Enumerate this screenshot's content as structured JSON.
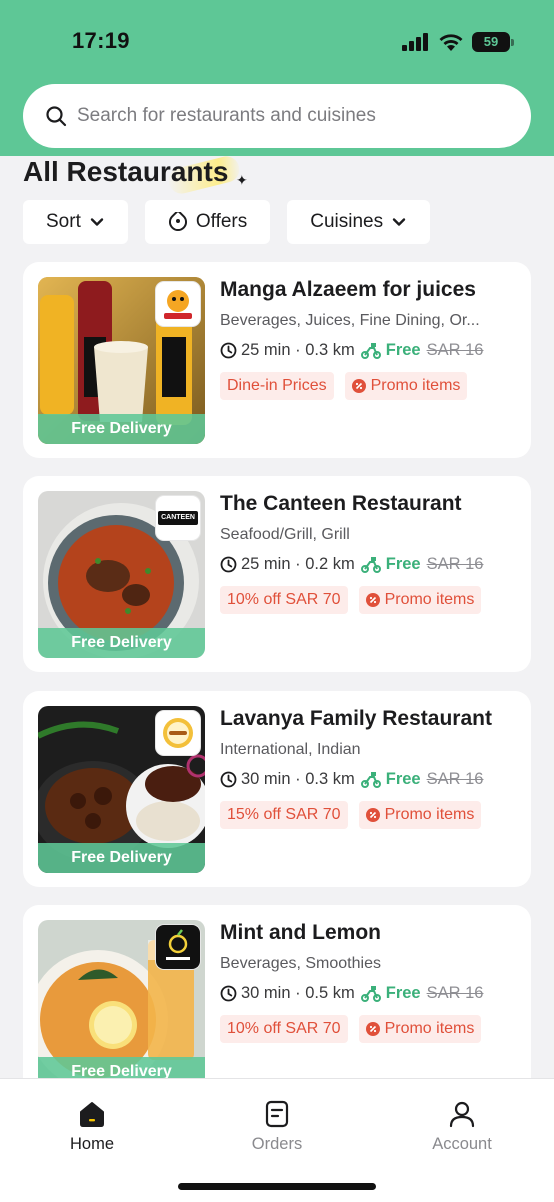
{
  "status_bar": {
    "time": "17:19",
    "battery": "59"
  },
  "search": {
    "placeholder": "Search for restaurants and cuisines"
  },
  "section": {
    "title": "All Restaurants"
  },
  "filters": [
    {
      "label": "Sort",
      "icon": "chevron-down-icon"
    },
    {
      "label": "Offers",
      "icon": "tag-icon"
    },
    {
      "label": "Cuisines",
      "icon": "chevron-down-icon"
    }
  ],
  "restaurants": [
    {
      "name": "Manga Alzaeem for juices",
      "cuisines": "Beverages, Juices, Fine Dining, Or...",
      "time": "25 min",
      "distance": "0.3 km",
      "delivery": "Free",
      "old_fee": "SAR 16",
      "badge": "Free Delivery",
      "tags": [
        "Dine-in Prices",
        "Promo items"
      ]
    },
    {
      "name": "The Canteen Restaurant",
      "cuisines": "Seafood/Grill, Grill",
      "time": "25 min",
      "distance": "0.2 km",
      "delivery": "Free",
      "old_fee": "SAR 16",
      "badge": "Free Delivery",
      "logo_text": "CANTEEN",
      "tags": [
        "10% off SAR 70",
        "Promo items"
      ]
    },
    {
      "name": "Lavanya Family Restaurant",
      "cuisines": "International, Indian",
      "time": "30 min",
      "distance": "0.3 km",
      "delivery": "Free",
      "old_fee": "SAR 16",
      "badge": "Free Delivery",
      "tags": [
        "15% off SAR 70",
        "Promo items"
      ]
    },
    {
      "name": "Mint and Lemon",
      "cuisines": "Beverages, Smoothies",
      "time": "30 min",
      "distance": "0.5 km",
      "delivery": "Free",
      "old_fee": "SAR 16",
      "badge": "Free Delivery",
      "tags": [
        "10% off SAR 70",
        "Promo items"
      ]
    }
  ],
  "tabbar": [
    {
      "label": "Home",
      "icon": "home-icon",
      "active": true
    },
    {
      "label": "Orders",
      "icon": "orders-icon",
      "active": false
    },
    {
      "label": "Account",
      "icon": "account-icon",
      "active": false
    }
  ],
  "colors": {
    "brand": "#5ec796",
    "promo": "#e0503a",
    "promo_bg": "#fdecea",
    "free": "#3bb07a"
  }
}
